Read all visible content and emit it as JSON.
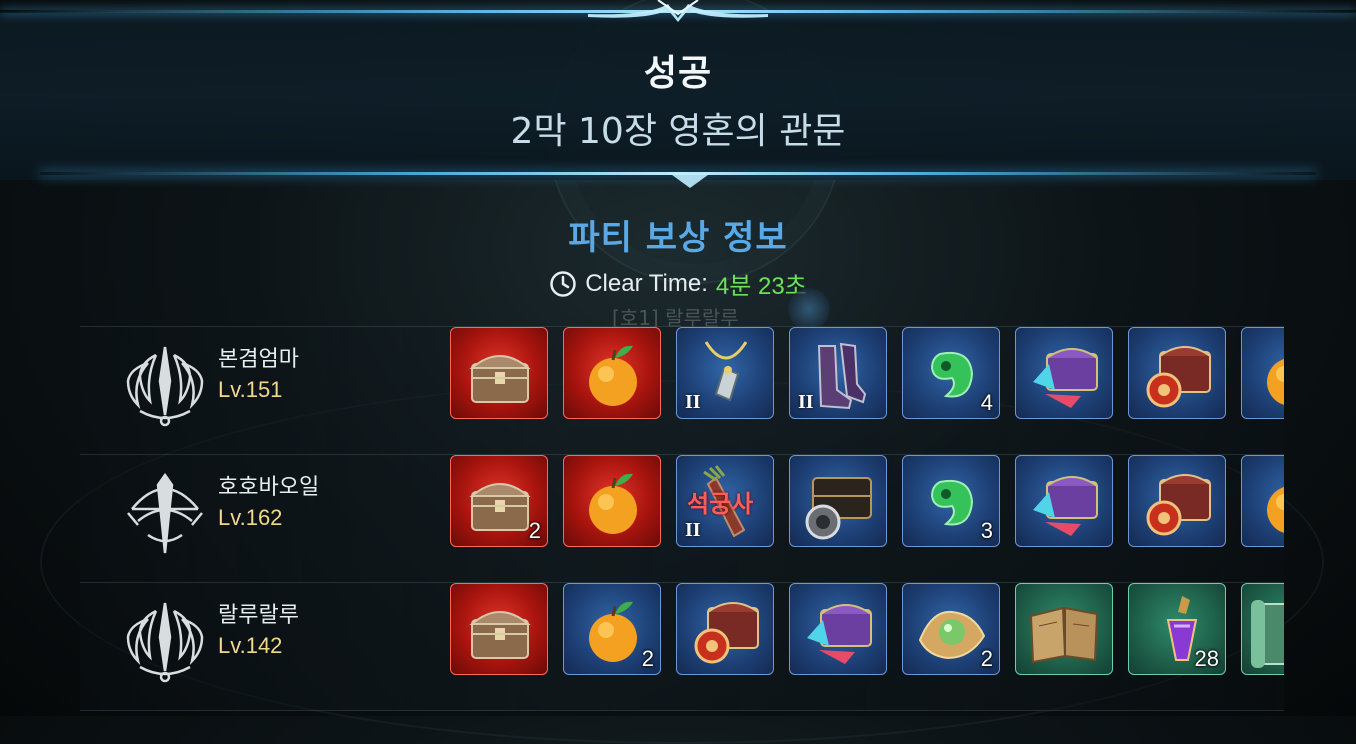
{
  "header": {
    "result": "성공",
    "stage": "2막 10장 영혼의 관문"
  },
  "rewards": {
    "title": "파티 보상 정보",
    "clear_time_label": "Clear Time:",
    "clear_time_value": "4분 23초",
    "ghost_tag": "[호1] 랄루랄루"
  },
  "players": [
    {
      "name": "본겸엄마",
      "level": "Lv.151",
      "class_icon": "blade-emblem-icon",
      "items": [
        {
          "icon": "treasure-chest-icon",
          "rarity": "red",
          "count": "",
          "tier": "",
          "overlay": ""
        },
        {
          "icon": "golden-fruit-icon",
          "rarity": "red",
          "count": "",
          "tier": "",
          "overlay": ""
        },
        {
          "icon": "amulet-necklace-icon",
          "rarity": "blue",
          "count": "",
          "tier": "II",
          "overlay": ""
        },
        {
          "icon": "armored-boots-icon",
          "rarity": "blue",
          "count": "",
          "tier": "II",
          "overlay": ""
        },
        {
          "icon": "jade-magatama-icon",
          "rarity": "blue",
          "count": "4",
          "tier": "",
          "overlay": ""
        },
        {
          "icon": "purple-crystal-chest-icon",
          "rarity": "blue",
          "count": "",
          "tier": "",
          "overlay": ""
        },
        {
          "icon": "ornate-chest-orb-icon",
          "rarity": "blue",
          "count": "",
          "tier": "",
          "overlay": ""
        },
        {
          "icon": "golden-fruit-icon",
          "rarity": "blue",
          "count": "",
          "tier": "",
          "overlay": ""
        }
      ]
    },
    {
      "name": "호호바오일",
      "level": "Lv.162",
      "class_icon": "bow-emblem-icon",
      "items": [
        {
          "icon": "treasure-chest-icon",
          "rarity": "red",
          "count": "2",
          "tier": "",
          "overlay": ""
        },
        {
          "icon": "golden-fruit-icon",
          "rarity": "red",
          "count": "",
          "tier": "",
          "overlay": ""
        },
        {
          "icon": "arrow-quiver-icon",
          "rarity": "blue",
          "count": "",
          "tier": "II",
          "overlay": "석궁사"
        },
        {
          "icon": "dark-chest-coin-icon",
          "rarity": "blue",
          "count": "",
          "tier": "",
          "overlay": ""
        },
        {
          "icon": "jade-magatama-icon",
          "rarity": "blue",
          "count": "3",
          "tier": "",
          "overlay": ""
        },
        {
          "icon": "purple-crystal-chest-icon",
          "rarity": "blue",
          "count": "",
          "tier": "",
          "overlay": ""
        },
        {
          "icon": "ornate-chest-orb-icon",
          "rarity": "blue",
          "count": "",
          "tier": "",
          "overlay": ""
        },
        {
          "icon": "golden-fruit-icon",
          "rarity": "blue",
          "count": "",
          "tier": "",
          "overlay": ""
        }
      ]
    },
    {
      "name": "랄루랄루",
      "level": "Lv.142",
      "class_icon": "blade-emblem-icon",
      "items": [
        {
          "icon": "treasure-chest-icon",
          "rarity": "red",
          "count": "",
          "tier": "",
          "overlay": ""
        },
        {
          "icon": "golden-fruit-icon",
          "rarity": "blue",
          "count": "2",
          "tier": "",
          "overlay": ""
        },
        {
          "icon": "ornate-chest-orb-icon",
          "rarity": "blue",
          "count": "",
          "tier": "",
          "overlay": ""
        },
        {
          "icon": "purple-crystal-chest-icon",
          "rarity": "blue",
          "count": "",
          "tier": "",
          "overlay": ""
        },
        {
          "icon": "green-pearl-icon",
          "rarity": "blue",
          "count": "2",
          "tier": "",
          "overlay": ""
        },
        {
          "icon": "old-book-icon",
          "rarity": "green",
          "count": "",
          "tier": "",
          "overlay": ""
        },
        {
          "icon": "purple-potion-icon",
          "rarity": "green",
          "count": "28",
          "tier": "",
          "overlay": ""
        },
        {
          "icon": "scroll-icon",
          "rarity": "green",
          "count": "",
          "tier": "",
          "overlay": ""
        }
      ]
    }
  ],
  "colors": {
    "accent_blue": "#59a9e6",
    "time_green": "#6ee05a",
    "level_gold": "#f3d88a",
    "slot_red": "#c41f16",
    "slot_blue": "#1d3f74",
    "slot_green": "#1e5e49"
  }
}
